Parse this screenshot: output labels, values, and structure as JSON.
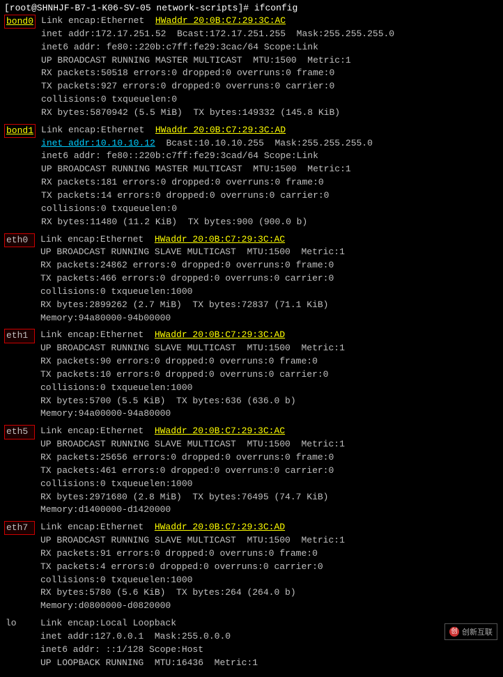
{
  "terminal": {
    "prompt": "[root@SHNHJF-B7-1-K06-SV-05 network-scripts]# ifconfig",
    "interfaces": [
      {
        "name": "bond0",
        "lines": [
          "Link encap:Ethernet  HWaddr 20:0B:C7:29:3C:AC          ",
          "inet addr:172.17.251.52  Bcast:172.17.251.255  Mask:255.255.255.0",
          "inet6 addr: fe80::220b:c7ff:fe29:3cac/64 Scope:Link",
          "UP BROADCAST RUNNING MASTER MULTICAST  MTU:1500  Metric:1",
          "RX packets:50518 errors:0 dropped:0 overruns:0 frame:0",
          "TX packets:927 errors:0 dropped:0 overruns:0 carrier:0",
          "collisions:0 txqueuelen:0",
          "RX bytes:5870942 (5.5 MiB)  TX bytes:149332 (145.8 KiB)"
        ],
        "nameHighlight": "yellow-underline",
        "hwaddrHighlight": true,
        "inetHighlight": false,
        "type": "bond"
      },
      {
        "name": "bond1",
        "lines": [
          "Link encap:Ethernet  HWaddr 20:0B:C7:29:3C:AD          ",
          "inet addr:10.10.10.12  Bcast:10.10.10.255  Mask:255.255.255.0",
          "inet6 addr: fe80::220b:c7ff:fe29:3cad/64 Scope:Link",
          "UP BROADCAST RUNNING MASTER MULTICAST  MTU:1500  Metric:1",
          "RX packets:181 errors:0 dropped:0 overruns:0 frame:0",
          "TX packets:14 errors:0 dropped:0 overruns:0 carrier:0",
          "collisions:0 txqueuelen:0",
          "RX bytes:11480 (11.2 KiB)  TX bytes:900 (900.0 b)"
        ],
        "nameHighlight": "yellow-underline",
        "hwaddrHighlight": true,
        "inetHighlight": true,
        "type": "bond"
      },
      {
        "name": "eth0",
        "lines": [
          "Link encap:Ethernet  HWaddr 20:0B:C7:29:3C:AC",
          "UP BROADCAST RUNNING SLAVE MULTICAST  MTU:1500  Metric:1",
          "RX packets:24862 errors:0 dropped:0 overruns:0 frame:0",
          "TX packets:466 errors:0 dropped:0 overruns:0 carrier:0",
          "collisions:0 txqueuelen:1000",
          "RX bytes:2899262 (2.7 MiB)  TX bytes:72837 (71.1 KiB)",
          "Memory:94a80000-94b00000"
        ],
        "nameHighlight": "none",
        "hwaddrHighlight": true,
        "inetHighlight": false,
        "type": "eth"
      },
      {
        "name": "eth1",
        "lines": [
          "Link encap:Ethernet  HWaddr 20:0B:C7:29:3C:AD",
          "UP BROADCAST RUNNING SLAVE MULTICAST  MTU:1500  Metric:1",
          "RX packets:90 errors:0 dropped:0 overruns:0 frame:0",
          "TX packets:10 errors:0 dropped:0 overruns:0 carrier:0",
          "collisions:0 txqueuelen:1000",
          "RX bytes:5700 (5.5 KiB)  TX bytes:636 (636.0 b)",
          "Memory:94a00000-94a80000"
        ],
        "nameHighlight": "none",
        "hwaddrHighlight": true,
        "inetHighlight": false,
        "type": "eth"
      },
      {
        "name": "eth5",
        "lines": [
          "Link encap:Ethernet  HWaddr 20:0B:C7:29:3C:AC",
          "UP BROADCAST RUNNING SLAVE MULTICAST  MTU:1500  Metric:1",
          "RX packets:25656 errors:0 dropped:0 overruns:0 frame:0",
          "TX packets:461 errors:0 dropped:0 overruns:0 carrier:0",
          "collisions:0 txqueuelen:1000",
          "RX bytes:2971680 (2.8 MiB)  TX bytes:76495 (74.7 KiB)",
          "Memory:d1400000-d1420000"
        ],
        "nameHighlight": "none",
        "hwaddrHighlight": true,
        "inetHighlight": false,
        "type": "eth"
      },
      {
        "name": "eth7",
        "lines": [
          "Link encap:Ethernet  HWaddr 20:0B:C7:29:3C:AD",
          "UP BROADCAST RUNNING SLAVE MULTICAST  MTU:1500  Metric:1",
          "RX packets:91 errors:0 dropped:0 overruns:0 frame:0",
          "TX packets:4 errors:0 dropped:0 overruns:0 carrier:0",
          "collisions:0 txqueuelen:1000",
          "RX bytes:5780 (5.6 KiB)  TX bytes:264 (264.0 b)",
          "Memory:d0800000-d0820000"
        ],
        "nameHighlight": "none",
        "hwaddrHighlight": true,
        "inetHighlight": false,
        "type": "eth"
      }
    ],
    "lo": {
      "name": "lo",
      "lines": [
        "Link encap:Local Loopback",
        "inet addr:127.0.0.1  Mask:255.0.0.0",
        "inet6 addr: ::1/128 Scope:Host",
        "UP LOOPBACK RUNNING  MTU:16436  Metric:1"
      ]
    },
    "watermark": "创新互联"
  }
}
